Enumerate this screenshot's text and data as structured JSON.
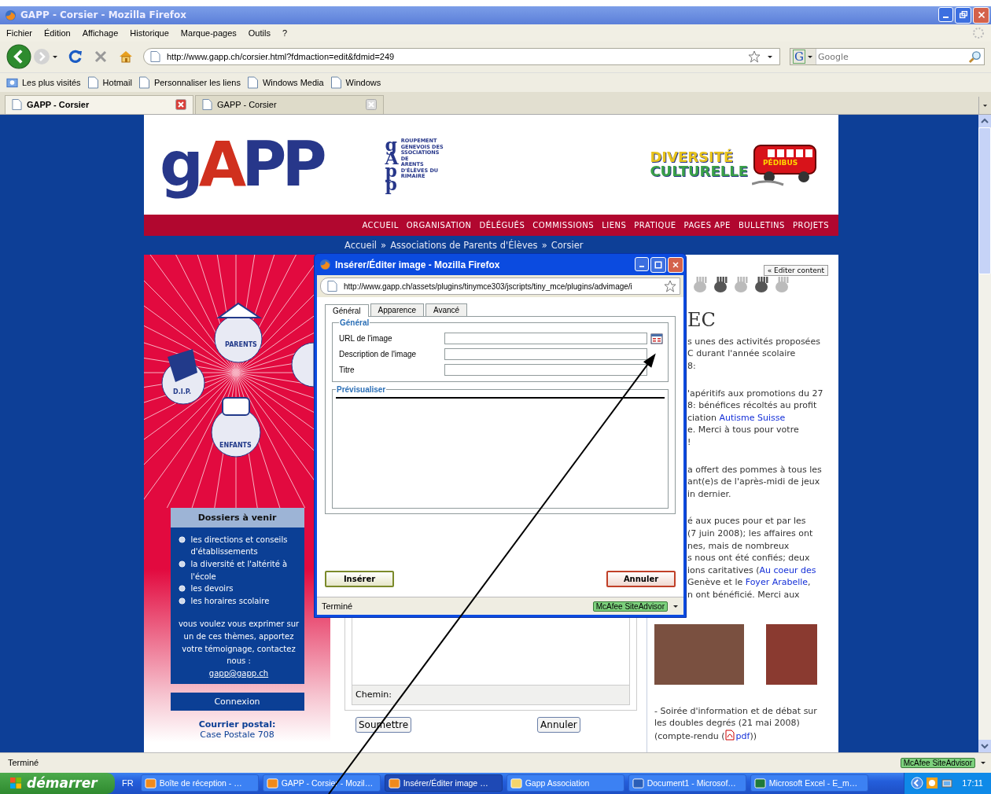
{
  "window": {
    "title": "GAPP - Corsier - Mozilla Firefox"
  },
  "menu": [
    "Fichier",
    "Édition",
    "Affichage",
    "Historique",
    "Marque-pages",
    "Outils",
    "?"
  ],
  "address_bar": {
    "value": "http://www.gapp.ch/corsier.html?fdmaction=edit&fdmid=249"
  },
  "search": {
    "engine": "G",
    "placeholder": "Google"
  },
  "bookmarks": [
    "Les plus visités",
    "Hotmail",
    "Personnaliser les liens",
    "Windows Media",
    "Windows"
  ],
  "tabs": [
    {
      "label": "GAPP - Corsier",
      "selected": true
    },
    {
      "label": "GAPP - Corsier",
      "selected": false
    }
  ],
  "site": {
    "logo": [
      {
        "text": "g",
        "accent": false
      },
      {
        "text": "A",
        "accent": true
      },
      {
        "text": "PP",
        "accent": false
      }
    ],
    "acronym_initials": [
      "g",
      "A",
      "p",
      "p"
    ],
    "acronym_lines": [
      "ROUPEMENT",
      "GENEVOIS DES",
      "SSOCIATIONS",
      "DE",
      "ARENTS",
      "D'ÉLÈVES DU",
      "RIMAIRE"
    ],
    "diversity_logo": [
      "DIVERSITÉ",
      "CULTURELLE"
    ],
    "bus_label": "PÉDIBUS",
    "nav": [
      "ACCUEIL",
      "ORGANISATION",
      "DÉLÉGUÉS",
      "COMMISSIONS",
      "LIENS",
      "PRATIQUE",
      "PAGES APE",
      "BULLETINS",
      "PROJETS"
    ],
    "breadcrumb": {
      "items": [
        "Accueil",
        "Associations de Parents d'Élèves",
        "Corsier"
      ],
      "separator": "»"
    },
    "illustration_labels": [
      "PARENTS",
      "D.I.P.",
      "ENFANTS"
    ],
    "sidebar": {
      "title": "Dossiers à venir",
      "items": [
        "les directions et conseils d'établissements",
        "la diversité et l'altérité à l'école",
        "les devoirs",
        "les horaires scolaire"
      ],
      "message": "vous voulez vous exprimer sur un de ces thèmes, apportez votre témoignage, contactez nous :",
      "email": "gapp@gapp.ch",
      "login": "Connexion",
      "postal_title": "Courrier postal:",
      "postal": "Case Postale 708"
    },
    "editor": {
      "path_label": "Chemin:",
      "buttons": [
        "Soumettre",
        "Annuler"
      ]
    },
    "content": {
      "edit_button": "« Editer content",
      "heading": "EC",
      "paragraphs": [
        [
          [
            {
              "kind": "text",
              "text": "s unes des activités proposées"
            }
          ],
          [
            {
              "kind": "text",
              "text": "C durant l'année scolaire"
            }
          ],
          [
            {
              "kind": "text",
              "text": "8:"
            }
          ]
        ],
        [
          [
            {
              "kind": "text",
              "text": "'apéritifs aux promotions du 27"
            }
          ],
          [
            {
              "kind": "text",
              "text": "8: bénéfices récoltés au profit"
            }
          ],
          [
            {
              "kind": "text",
              "text": "ciation "
            },
            {
              "kind": "link",
              "text": "Autisme Suisse"
            }
          ],
          [
            {
              "kind": "text",
              "text": "e. Merci à tous pour votre"
            }
          ],
          [
            {
              "kind": "text",
              "text": "!"
            }
          ]
        ],
        [
          [
            {
              "kind": "text",
              "text": "a offert des pommes à tous les"
            }
          ],
          [
            {
              "kind": "text",
              "text": "ant(e)s de l'après-midi de jeux"
            }
          ],
          [
            {
              "kind": "text",
              "text": "in dernier."
            }
          ]
        ],
        [
          [
            {
              "kind": "text",
              "text": "é aux puces pour et par les"
            }
          ],
          [
            {
              "kind": "text",
              "text": "(7 juin 2008); les affaires ont"
            }
          ],
          [
            {
              "kind": "text",
              "text": "nes, mais de nombreux"
            }
          ],
          [
            {
              "kind": "text",
              "text": "s nous ont été confiés; deux"
            }
          ],
          [
            {
              "kind": "text",
              "text": "ions caritatives ("
            },
            {
              "kind": "link",
              "text": "Au coeur des"
            }
          ],
          [
            {
              "kind": "text",
              "text": " Genève et le "
            },
            {
              "kind": "link",
              "text": "Foyer Arabelle"
            },
            {
              "kind": "text",
              "text": ","
            }
          ],
          [
            {
              "kind": "text",
              "text": "n ont bénéficié. Merci aux"
            }
          ]
        ]
      ],
      "after_photos": [
        [
          {
            "kind": "text",
            "text": "- Soirée d'information et de débat sur"
          }
        ],
        [
          {
            "kind": "text",
            "text": "les doubles degrés (21 mai 2008)"
          }
        ],
        [
          {
            "kind": "text",
            "text": "(compte-rendu ("
          },
          {
            "kind": "link",
            "text": "pdf",
            "attachment": true
          },
          {
            "kind": "text",
            "text": "))"
          }
        ]
      ]
    }
  },
  "dialog": {
    "title": "Insérer/Éditer image - Mozilla Firefox",
    "url": "http://www.gapp.ch/assets/plugins/tinymce303/jscripts/tiny_mce/plugins/advimage/i",
    "tabs": [
      {
        "label": "Général",
        "selected": true
      },
      {
        "label": "Apparence",
        "selected": false
      },
      {
        "label": "Avancé",
        "selected": false
      }
    ],
    "general_legend": "Général",
    "fields": [
      {
        "label": "URL de l'image",
        "browse": true
      },
      {
        "label": "Description de l'image",
        "browse": false
      },
      {
        "label": "Titre",
        "browse": false
      }
    ],
    "preview_legend": "Prévisualiser",
    "insert_button": "Insérer",
    "cancel_button": "Annuler",
    "status": "Terminé",
    "addon": "McAfee SiteAdvisor"
  },
  "status_bar": {
    "text": "Terminé",
    "addon": "McAfee SiteAdvisor"
  },
  "taskbar": {
    "start": "démarrer",
    "language": "FR",
    "items": [
      {
        "label": "Boîte de réception - …",
        "selected": false
      },
      {
        "label": "GAPP - Corsier - Mozil…",
        "selected": false
      },
      {
        "label": "Insérer/Éditer image …",
        "selected": true
      },
      {
        "label": "Gapp Association",
        "selected": false
      },
      {
        "label": "Document1 - Microsof…",
        "selected": false
      },
      {
        "label": "Microsoft Excel - E_m…",
        "selected": false
      }
    ],
    "clock": "17:11"
  }
}
